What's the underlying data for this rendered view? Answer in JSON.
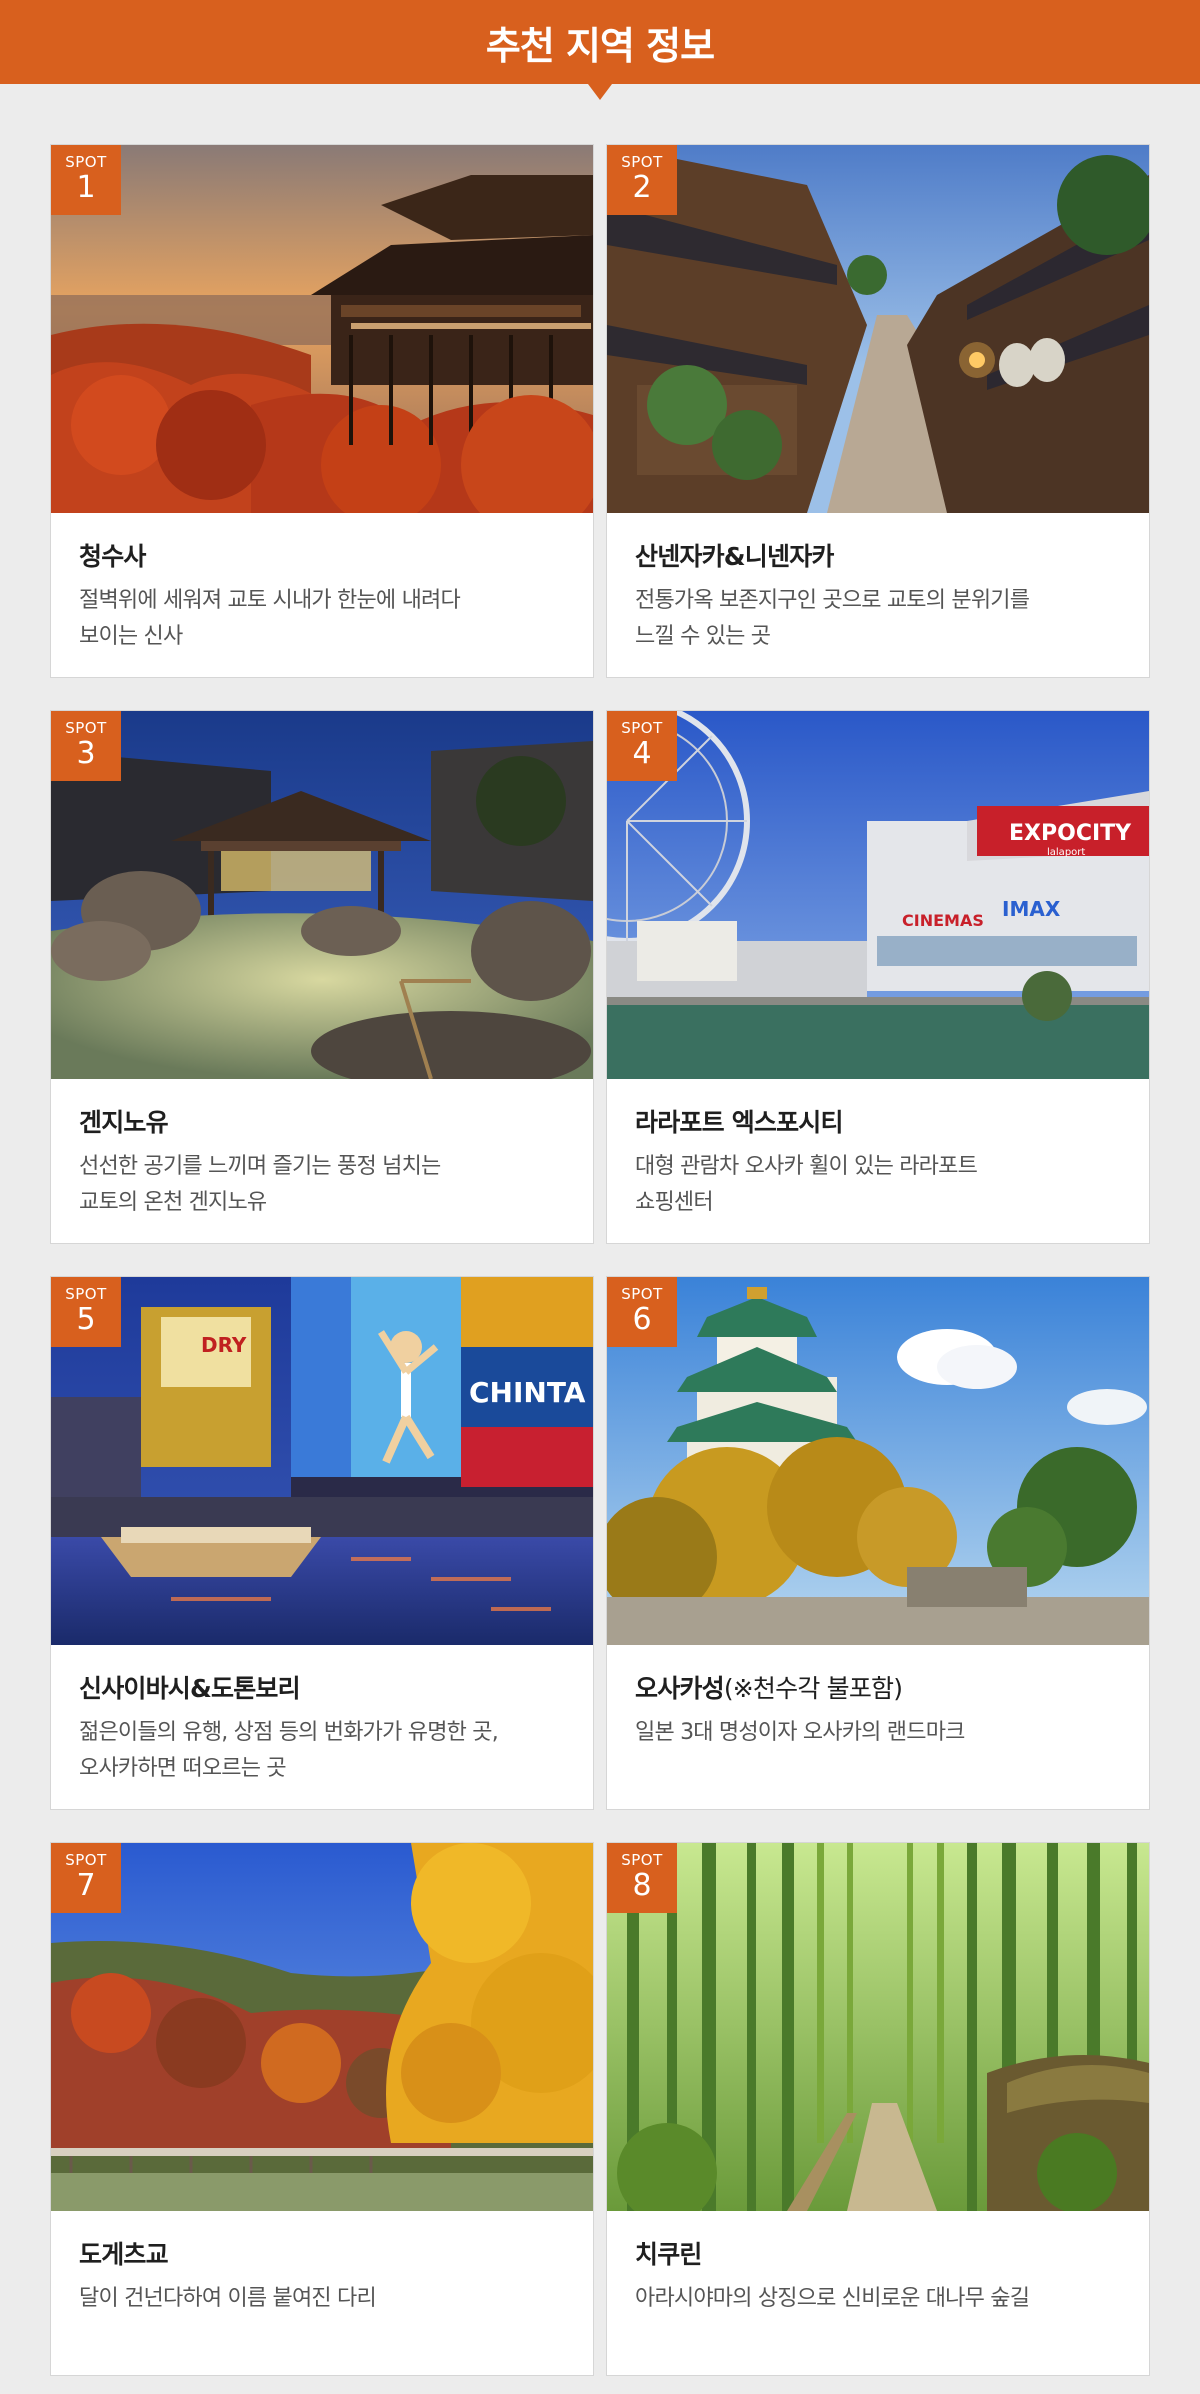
{
  "header": {
    "title": "추천 지역 정보"
  },
  "badge_label": "SPOT",
  "spots": [
    {
      "number": "1",
      "title": "청수사",
      "title_note": "",
      "description": "절벽위에 세워져 교토 시내가 한눈에 내려다\n보이는 신사"
    },
    {
      "number": "2",
      "title": "산넨자카&니넨자카",
      "title_note": "",
      "description": "전통가옥 보존지구인 곳으로 교토의 분위기를\n느낄 수 있는 곳"
    },
    {
      "number": "3",
      "title": "겐지노유",
      "title_note": "",
      "description": "선선한 공기를 느끼며 즐기는 풍정 넘치는\n교토의 온천 겐지노유"
    },
    {
      "number": "4",
      "title": "라라포트 엑스포시티",
      "title_note": "",
      "description": "대형 관람차 오사카 휠이 있는 라라포트\n쇼핑센터"
    },
    {
      "number": "5",
      "title": "신사이바시&도톤보리",
      "title_note": "",
      "description": "젊은이들의 유행, 상점 등의 번화가가 유명한 곳,\n오사카하면 떠오르는 곳"
    },
    {
      "number": "6",
      "title": "오사카성",
      "title_note": "(※천수각 불포함)",
      "description": "일본 3대 명성이자 오사카의 랜드마크"
    },
    {
      "number": "7",
      "title": "도게츠교",
      "title_note": "",
      "description": "달이 건넌다하여 이름 붙여진 다리"
    },
    {
      "number": "8",
      "title": "치쿠린",
      "title_note": "",
      "description": "아라시야마의 상징으로 신비로운 대나무 숲길"
    }
  ],
  "photo_signs": {
    "expocity": "EXPOCITY",
    "lalaport": "lalaport",
    "cinemas": "CINEMAS",
    "imax": "IMAX",
    "chinta": "CHINTA",
    "dry": "DRY"
  },
  "colors": {
    "accent": "#d8601e",
    "background": "#ececec",
    "card": "#ffffff",
    "title_text": "#1f1f1f",
    "desc_text": "#555555"
  }
}
